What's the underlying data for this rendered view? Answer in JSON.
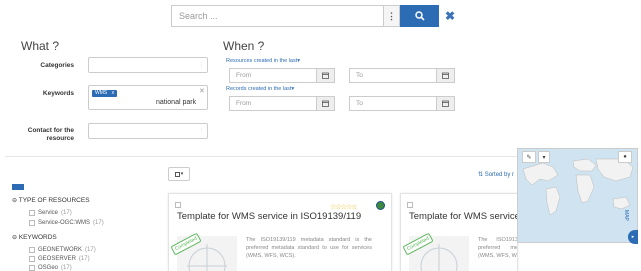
{
  "search": {
    "placeholder": "Search ..."
  },
  "what": {
    "header": "What ?",
    "categories_label": "Categories",
    "keywords_label": "Keywords",
    "keyword_tag": "WMS",
    "keyword_remove": "x",
    "keyword_value": "national park",
    "contact_label": "Contact for the resource"
  },
  "when": {
    "header": "When ?",
    "resources_link": "Resources created in the last▾",
    "records_link": "Records created in the last▾",
    "from_placeholder": "From",
    "to_placeholder": "To"
  },
  "results": {
    "sorted_by": "Sorted by r"
  },
  "facets": {
    "type_header": "TYPE OF RESOURCES",
    "type_items": [
      {
        "label": "Service",
        "count": "(17)"
      },
      {
        "label": "Service-OGC:WMS",
        "count": "(17)"
      }
    ],
    "keywords_header": "KEYWORDS",
    "keyword_items": [
      {
        "label": "GEONETWORK",
        "count": "(17)"
      },
      {
        "label": "GEOSERVER",
        "count": "(17)"
      },
      {
        "label": "OSGeo",
        "count": "(17)"
      }
    ]
  },
  "cards": [
    {
      "title": "Template for WMS service in ISO19139/119",
      "abstract": "The ISO19139/119 metadata standard is the preferred metadata standard to use for services (WMS, WFS, WCS).",
      "badge": "Completed"
    },
    {
      "title": "Template for WMS service",
      "abstract": "The ISO1913 preferred me (WMS, WFS, W",
      "badge": "Completed"
    }
  ],
  "map": {
    "side_label": "MAP"
  },
  "colors": {
    "primary": "#2b6cb5",
    "success": "#5cb85c",
    "star": "#e6b800",
    "ocean": "#cfe3f0",
    "land": "#f2f2f2"
  },
  "icons": [
    "search-icon",
    "close-icon",
    "menu-dots-icon",
    "calendar-icon",
    "star-icon",
    "globe-icon",
    "pencil-icon",
    "chevron-down-icon",
    "chevron-right-icon",
    "square-icon"
  ]
}
